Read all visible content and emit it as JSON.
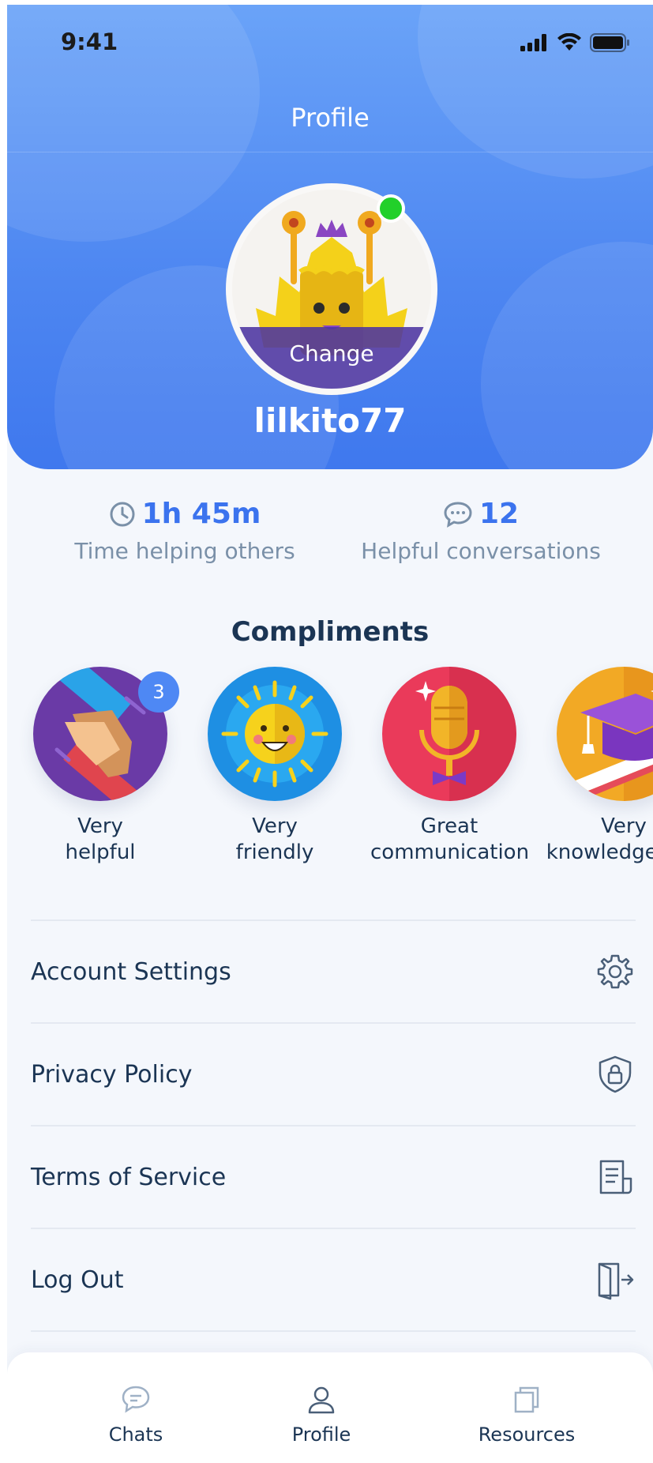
{
  "status_bar": {
    "time": "9:41"
  },
  "header": {
    "title": "Profile"
  },
  "profile": {
    "avatar_action": "Change",
    "username": "lilkito77"
  },
  "stats": {
    "time_helping": {
      "value": "1h 45m",
      "label": "Time helping others"
    },
    "conversations": {
      "value": "12",
      "label": "Helpful conversations"
    }
  },
  "compliments": {
    "title": "Compliments",
    "items": [
      {
        "line1": "Very",
        "line2": "helpful",
        "count": "3"
      },
      {
        "line1": "Very",
        "line2": "friendly"
      },
      {
        "line1": "Great",
        "line2": "communication"
      },
      {
        "line1": "Very",
        "line2": "knowledgeable"
      }
    ]
  },
  "menu": {
    "items": [
      {
        "label": "Account Settings",
        "icon": "gear-icon"
      },
      {
        "label": "Privacy Policy",
        "icon": "shield-lock-icon"
      },
      {
        "label": "Terms of Service",
        "icon": "document-icon"
      },
      {
        "label": "Log Out",
        "icon": "logout-door-icon"
      }
    ]
  },
  "tabbar": {
    "tabs": [
      {
        "label": "Chats",
        "icon": "chat-bubble-icon",
        "active": false
      },
      {
        "label": "Profile",
        "icon": "user-icon",
        "active": true
      },
      {
        "label": "Resources",
        "icon": "copy-pages-icon",
        "active": false
      }
    ]
  },
  "colors": {
    "accent": "#3b73ee",
    "text_dark": "#1b3554",
    "text_muted": "#7a90a8",
    "online": "#22d02a"
  }
}
